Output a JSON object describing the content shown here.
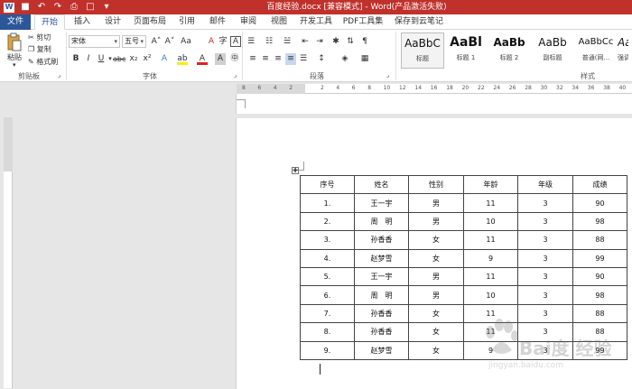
{
  "title_bar": {
    "document_title": "百度经验.docx [兼容模式] - Word(产品激活失败)",
    "qat": [
      {
        "icon": "word-logo-icon",
        "glyph": "W"
      },
      {
        "icon": "save-icon",
        "glyph": "■"
      },
      {
        "icon": "undo-icon",
        "glyph": "↶"
      },
      {
        "icon": "redo-icon",
        "glyph": "↷"
      },
      {
        "icon": "print-preview-icon",
        "glyph": "⎙"
      },
      {
        "icon": "new-document-icon",
        "glyph": "□"
      },
      {
        "icon": "customize-qat-icon",
        "glyph": "▾"
      }
    ]
  },
  "tabs": [
    "文件",
    "开始",
    "插入",
    "设计",
    "页面布局",
    "引用",
    "邮件",
    "审阅",
    "视图",
    "开发工具",
    "PDF工具集",
    "保存到云笔记"
  ],
  "ribbon": {
    "clipboard": {
      "paste": "粘贴",
      "cut": "剪切",
      "copy": "复制",
      "format_painter": "格式刷",
      "group_label": "剪贴板"
    },
    "font": {
      "font_name": "宋体",
      "font_size": "五号",
      "grow": "A˄",
      "shrink": "A˅",
      "change_case": "Aa",
      "clear_format": "A",
      "bold": "B",
      "italic": "I",
      "underline": "U",
      "strike": "abc",
      "subscript": "x₂",
      "superscript": "x²",
      "text_effects": "A",
      "highlight": "ab",
      "font_color": "A",
      "char_shading": "A",
      "char_border": "A",
      "enclose": "字",
      "group_label": "字体"
    },
    "paragraph": {
      "group_label": "段落"
    },
    "styles": {
      "items": [
        {
          "preview": "AaBbC",
          "label": "标题"
        },
        {
          "preview": "AaBl",
          "label": "标题 1"
        },
        {
          "preview": "AaBb",
          "label": "标题 2"
        },
        {
          "preview": "AaBb",
          "label": "副标题"
        },
        {
          "preview": "AaBbCc",
          "label": "普通(网..."
        },
        {
          "preview": "AaBbC",
          "label": "强调"
        }
      ],
      "group_label": "样式"
    }
  },
  "ruler": {
    "ticks": [
      "8",
      "6",
      "4",
      "2",
      "",
      "2",
      "4",
      "6",
      "8",
      "10",
      "12",
      "14",
      "16",
      "18",
      "20",
      "22",
      "24",
      "26",
      "28",
      "30",
      "32",
      "34",
      "36",
      "38",
      "40"
    ]
  },
  "table": {
    "headers": [
      "序号",
      "姓名",
      "性别",
      "年龄",
      "年级",
      "成绩"
    ],
    "rows": [
      [
        "1.",
        "王一宇",
        "男",
        "11",
        "3",
        "90"
      ],
      [
        "2.",
        "周　明",
        "男",
        "10",
        "3",
        "98"
      ],
      [
        "3.",
        "孙香香",
        "女",
        "11",
        "3",
        "88"
      ],
      [
        "4.",
        "赵梦雪",
        "女",
        "9",
        "3",
        "99"
      ],
      [
        "5.",
        "王一宇",
        "男",
        "11",
        "3",
        "90"
      ],
      [
        "6.",
        "周　明",
        "男",
        "10",
        "3",
        "98"
      ],
      [
        "7.",
        "孙香香",
        "女",
        "11",
        "3",
        "88"
      ],
      [
        "8.",
        "孙香香",
        "女",
        "11",
        "3",
        "88"
      ],
      [
        "9.",
        "赵梦雪",
        "女",
        "9",
        "3",
        "99"
      ]
    ]
  },
  "watermark": {
    "text": "Bai度 经验",
    "url": "jingyan.baidu.com"
  }
}
